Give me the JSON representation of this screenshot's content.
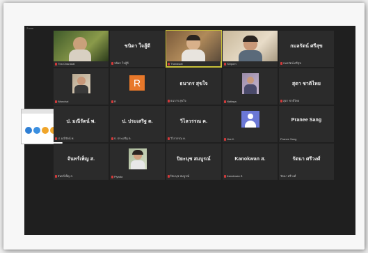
{
  "window": {
    "title": "Zoom"
  },
  "shared_screen": {
    "title": ""
  },
  "colors": {
    "active_border": "#c9c23a",
    "mic_muted": "#d23a3a",
    "avatar_r": "#e8782a",
    "avatar_default": "#6b78d6"
  },
  "participants": [
    {
      "name": "",
      "label": "Tha Chanarat"
    },
    {
      "name": "ชนิดา ใจสู้ดี",
      "label": "ชนิดา ใจสู้ดี"
    },
    {
      "name": "",
      "label": "Thanawat"
    },
    {
      "name": "",
      "label": "Siriporn"
    },
    {
      "name": "กมลรัตน์ ศรีสุข",
      "label": "กมลรัตน์ ศรีสุข"
    },
    {
      "name": "",
      "label": "Wanchai"
    },
    {
      "name": "",
      "label": "R",
      "avatar": "R"
    },
    {
      "name": "ธนากร สุขใจ",
      "label": "ธนากร สุขใจ"
    },
    {
      "name": "",
      "label": "Nattaya"
    },
    {
      "name": "สุดา ชาติไทย",
      "label": "สุดา ชาติไทย"
    },
    {
      "name": "ป. มณีรัตน์ พ.",
      "label": "ป. มณีรัตน์ พ."
    },
    {
      "name": "ป. ประเสริฐ ต.",
      "label": "ป. ประเสริฐ ต."
    },
    {
      "name": "วิไลวรรณ ค.",
      "label": "วิไลวรรณ ค."
    },
    {
      "name": "",
      "label": "Jira K."
    },
    {
      "name": "Pranee Sang",
      "label": "Pranee Sang"
    },
    {
      "name": "จันทร์เพ็ญ ส.",
      "label": "จันทร์เพ็ญ ส."
    },
    {
      "name": "",
      "label": "Piyada"
    },
    {
      "name": "ปิยะนุช สมบูรณ์",
      "label": "ปิยะนุช สมบูรณ์"
    },
    {
      "name": "Kanokwan ส.",
      "label": "Kanokwan ส."
    },
    {
      "name": "รัตนา ศรีวงศ์",
      "label": "รัตนา ศรีวงศ์"
    }
  ]
}
